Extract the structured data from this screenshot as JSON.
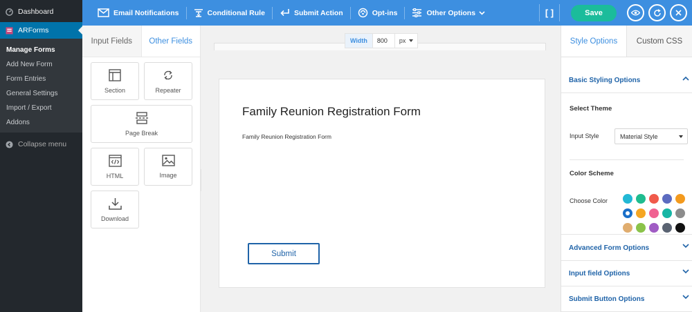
{
  "wp_menu": {
    "dashboard": "Dashboard",
    "arforms": "ARForms",
    "submenu": [
      "Manage Forms",
      "Add New Form",
      "Form Entries",
      "General Settings",
      "Import / Export",
      "Addons"
    ],
    "collapse": "Collapse menu"
  },
  "toolbar": {
    "email": "Email Notifications",
    "conditional": "Conditional Rule",
    "submit_action": "Submit Action",
    "optins": "Opt-ins",
    "other_options": "Other Options",
    "bracket": "[ ]",
    "save": "Save",
    "icons": [
      "envelope-icon",
      "conditional-rule-icon",
      "submit-action-icon",
      "optins-icon",
      "sliders-icon",
      "eye-icon",
      "refresh-icon",
      "close-icon"
    ]
  },
  "palette": {
    "tabs": [
      "Input Fields",
      "Other Fields"
    ],
    "active_tab": "Other Fields",
    "fields": [
      "Section",
      "Repeater",
      "Page Break",
      "HTML",
      "Image",
      "Download"
    ]
  },
  "canvas": {
    "width_label": "Width",
    "width_value": "800",
    "width_unit": "px",
    "form_title": "Family Reunion Registration Form",
    "form_description": "Family Reunion Registration Form",
    "submit_label": "Submit"
  },
  "right_panel": {
    "tabs": [
      "Style Options",
      "Custom CSS"
    ],
    "basic_styling": "Basic Styling Options",
    "select_theme": "Select Theme",
    "input_style_label": "Input Style",
    "input_style_value": "Material Style",
    "color_scheme": "Color Scheme",
    "choose_color": "Choose Color",
    "colors": [
      "#22b8d5",
      "#1fbc8f",
      "#f05a4b",
      "#5c6bc0",
      "#f39a1e",
      "#1a6fc9",
      "#f5a623",
      "#f06292",
      "#17b6a5",
      "#8c8c8c",
      "#e0ad6f",
      "#8bc34a",
      "#a05cc4",
      "#5a6372",
      "#111111"
    ],
    "selected_color": "#1a6fc9",
    "advanced": "Advanced Form Options",
    "input_field": "Input field Options",
    "submit_button": "Submit Button Options"
  },
  "colors": {
    "accent": "#3d8fe0",
    "save": "#1bbc9b",
    "wp_sidebar": "#23282d",
    "wp_active": "#0073aa"
  }
}
